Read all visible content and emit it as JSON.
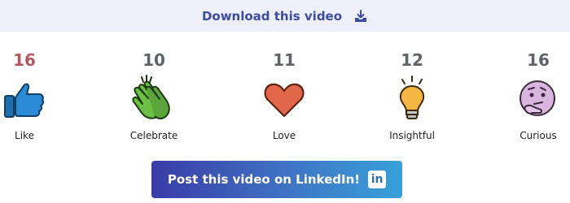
{
  "header": {
    "download_label": "Download this video",
    "download_icon": "download-tray-icon",
    "link_color": "#3d4ba3"
  },
  "reactions": [
    {
      "count": "16",
      "label": "Like",
      "icon": "thumbs-up-icon"
    },
    {
      "count": "10",
      "label": "Celebrate",
      "icon": "clapping-hands-icon"
    },
    {
      "count": "11",
      "label": "Love",
      "icon": "heart-icon"
    },
    {
      "count": "12",
      "label": "Insightful",
      "icon": "lightbulb-icon"
    },
    {
      "count": "16",
      "label": "Curious",
      "icon": "thinking-face-icon"
    }
  ],
  "cta": {
    "label": "Post this video on LinkedIn!",
    "icon_text": "in",
    "icon": "linkedin-icon",
    "gradient": [
      "#3a3ba6",
      "#37a1d9"
    ]
  }
}
